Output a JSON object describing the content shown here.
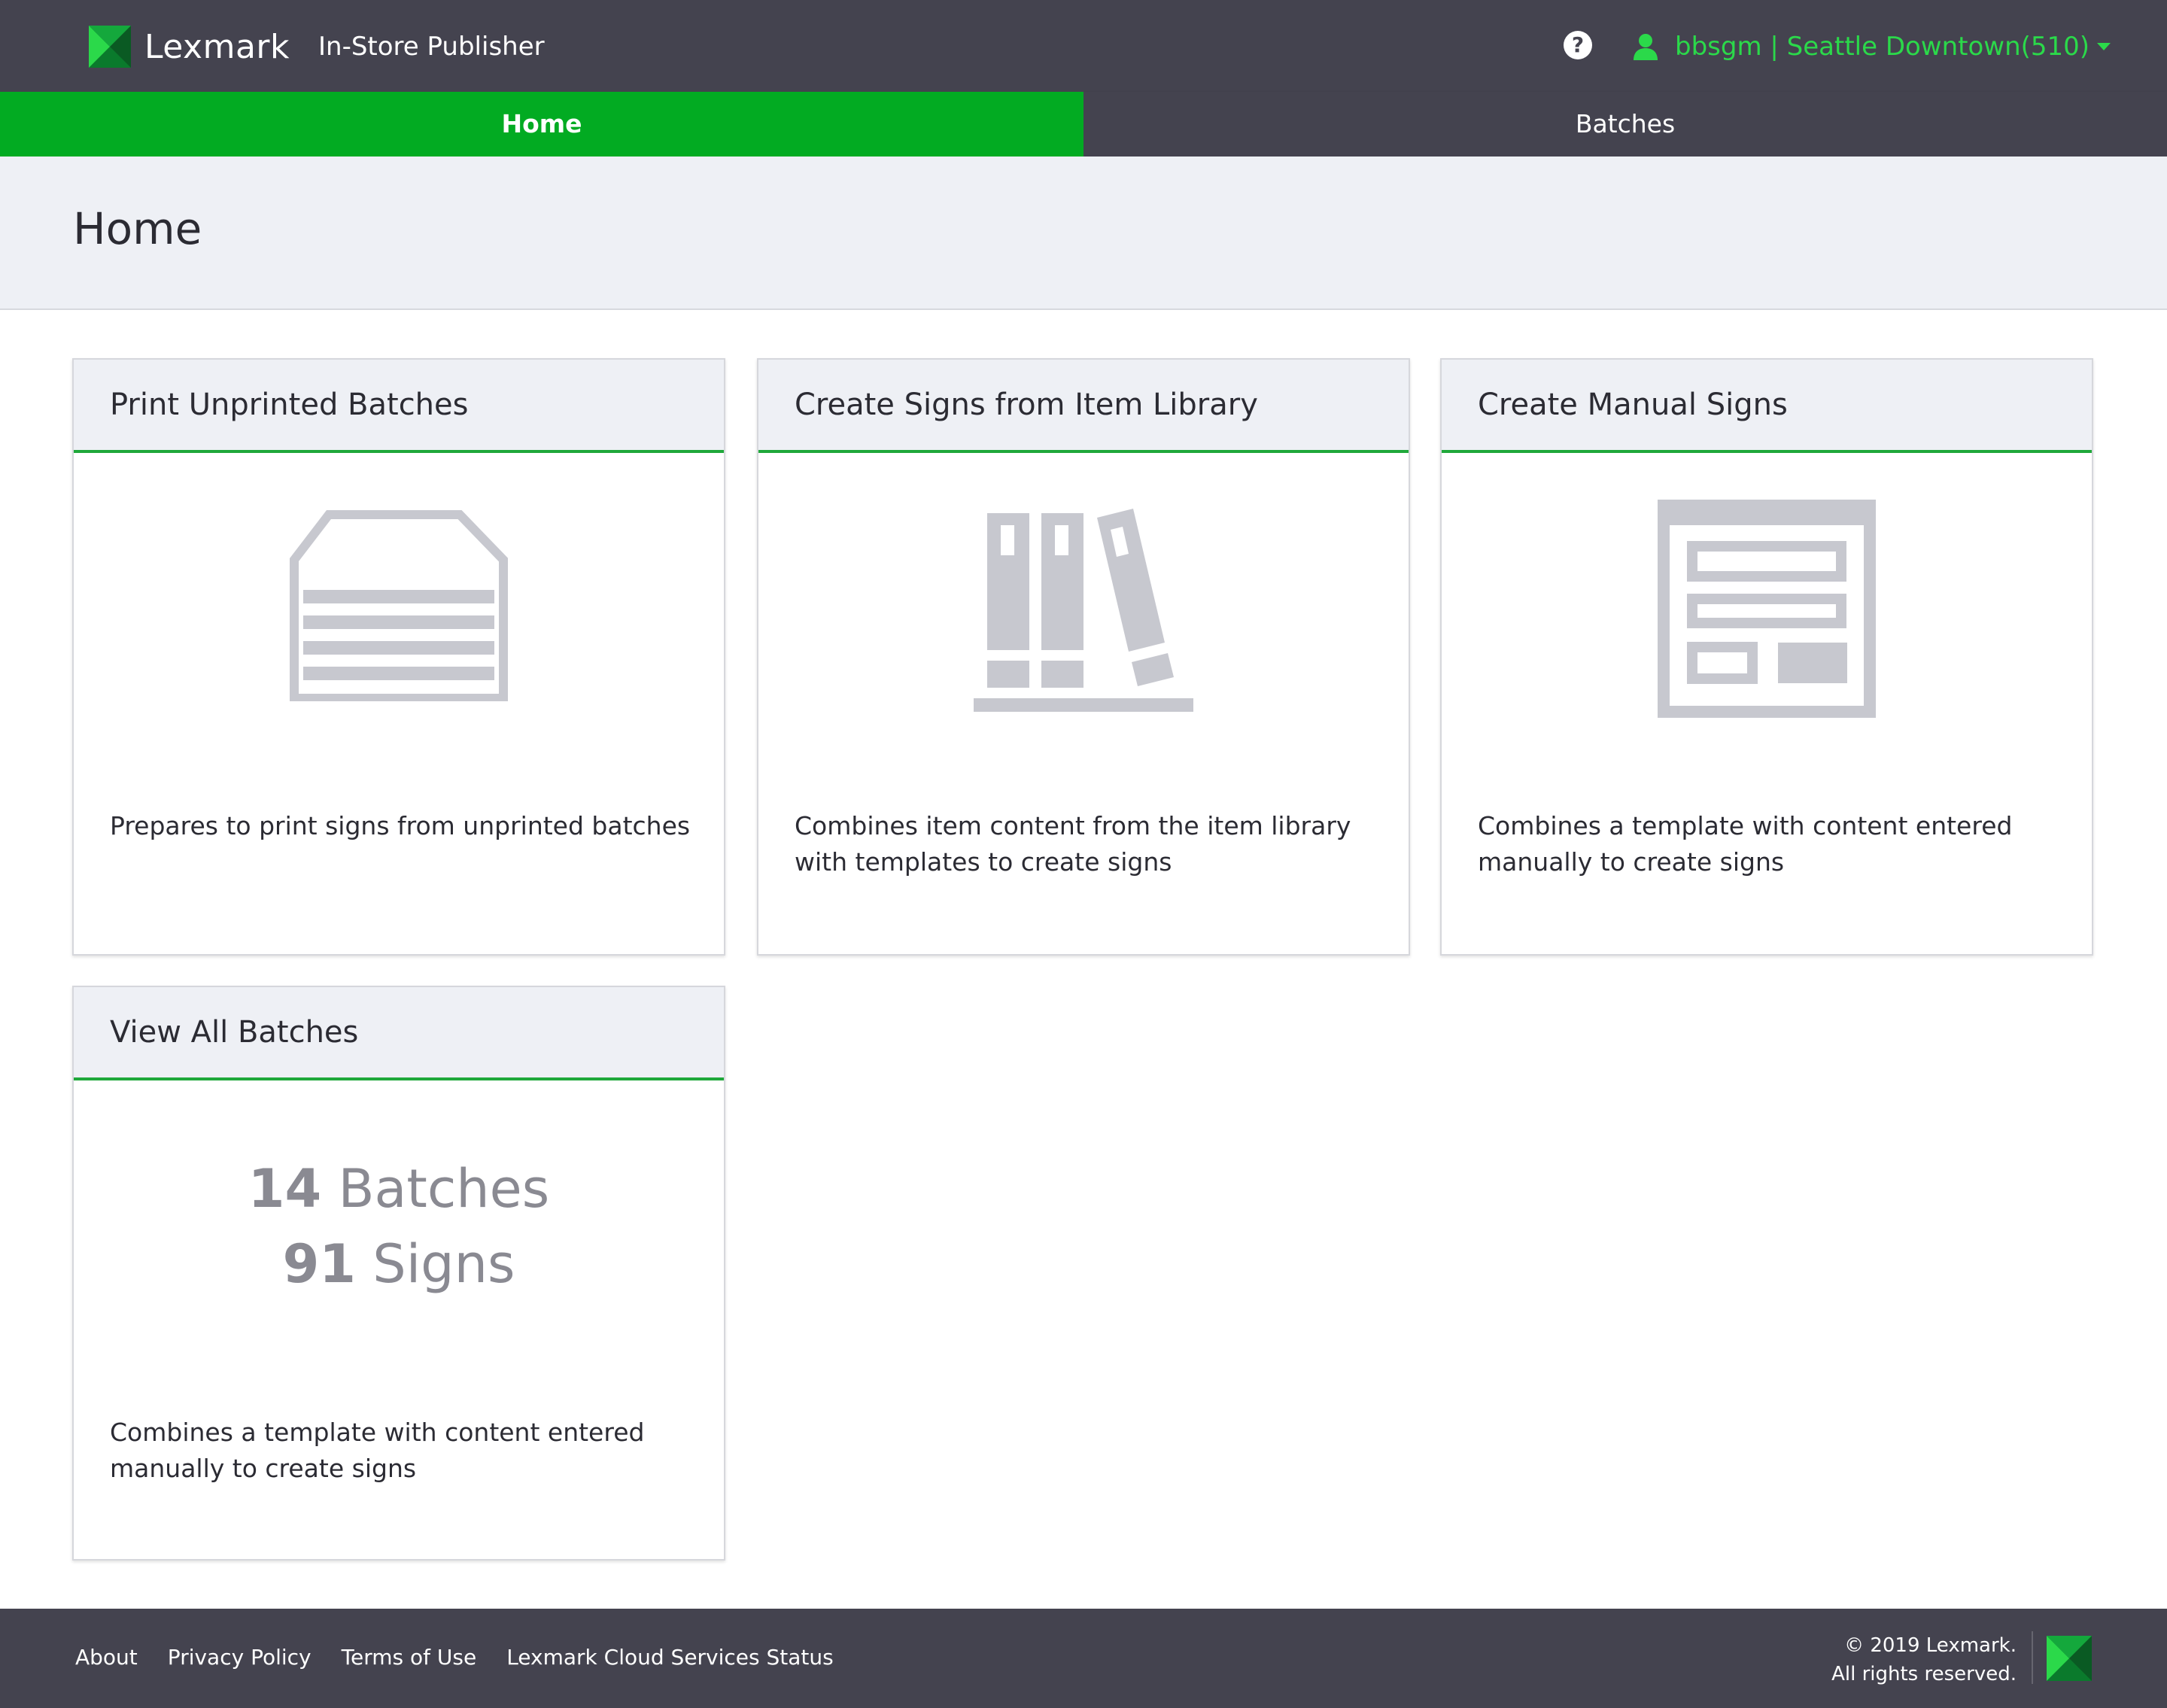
{
  "header": {
    "brand": "Lexmark",
    "app_name": "In-Store Publisher",
    "help_icon": "question-circle-icon",
    "user_label": "bbsgm | Seattle Downtown(510)",
    "accent_color": "#2bd94a"
  },
  "tabs": [
    {
      "label": "Home",
      "active": true
    },
    {
      "label": "Batches",
      "active": false
    }
  ],
  "page": {
    "title": "Home"
  },
  "cards": [
    {
      "title": "Print Unprinted Batches",
      "icon": "printer-tray-icon",
      "description": "Prepares to print signs from unprinted batches"
    },
    {
      "title": "Create Signs from Item Library",
      "icon": "books-library-icon",
      "description": "Combines item content from the item library with templates to create signs"
    },
    {
      "title": "Create Manual Signs",
      "icon": "document-template-icon",
      "description": "Combines a template with content entered manually to create signs"
    },
    {
      "title": "View All Batches",
      "batches_count": "14",
      "batches_label": "Batches",
      "signs_count": "91",
      "signs_label": "Signs",
      "description": "Combines a template with content entered manually to create signs"
    }
  ],
  "footer": {
    "links": [
      "About",
      "Privacy Policy",
      "Terms of Use",
      "Lexmark Cloud Services Status"
    ],
    "copyright_line1": "© 2019 Lexmark.",
    "copyright_line2": "All rights reserved."
  }
}
